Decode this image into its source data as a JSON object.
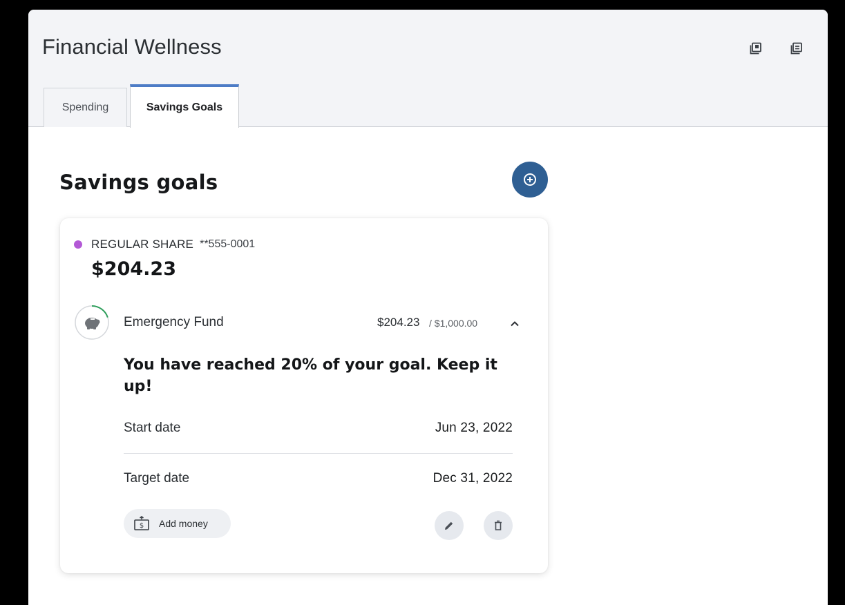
{
  "header": {
    "title": "Financial Wellness",
    "icons": [
      "minimize-window-icon",
      "expand-window-icon"
    ]
  },
  "tabs": [
    {
      "label": "Spending",
      "active": false
    },
    {
      "label": "Savings Goals",
      "active": true
    }
  ],
  "main": {
    "section_title": "Savings goals",
    "add_goal_icon": "plus-circle-icon"
  },
  "card": {
    "account": {
      "name": "REGULAR SHARE",
      "number": "**555-0001",
      "dot_color": "#b359d6",
      "balance": "$204.23"
    },
    "goal": {
      "name": "Emergency Fund",
      "icon": "piggy-bank-icon",
      "saved": "$204.23",
      "target": "/ $1,000.00",
      "progress_fraction": 0.2,
      "progress_color": "#2e9e5b",
      "message": "You have reached 20% of your goal. Keep it up!",
      "start_label": "Start date",
      "start_value": "Jun 23, 2022",
      "target_label": "Target date",
      "target_value": "Dec 31, 2022"
    },
    "actions": {
      "add_money_label": "Add money",
      "add_money_icon": "money-transfer-icon",
      "edit_icon": "pencil-icon",
      "delete_icon": "trash-icon"
    }
  },
  "colors": {
    "accent": "#2f5f93",
    "tab_indicator": "#4d7cc6"
  }
}
